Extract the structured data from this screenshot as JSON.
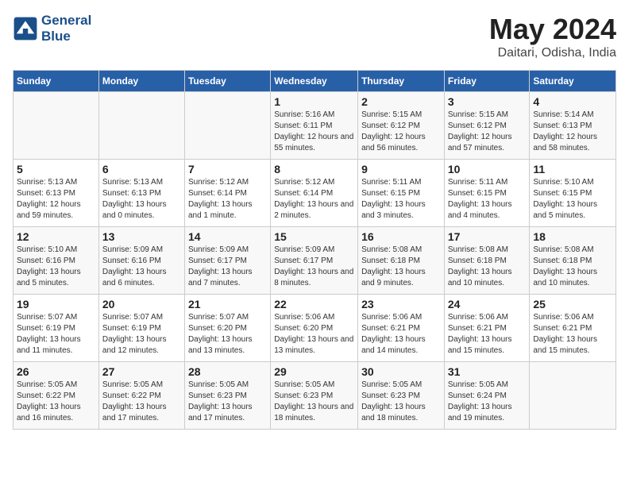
{
  "header": {
    "logo_line1": "General",
    "logo_line2": "Blue",
    "month": "May 2024",
    "location": "Daitari, Odisha, India"
  },
  "weekdays": [
    "Sunday",
    "Monday",
    "Tuesday",
    "Wednesday",
    "Thursday",
    "Friday",
    "Saturday"
  ],
  "weeks": [
    [
      {
        "day": "",
        "info": ""
      },
      {
        "day": "",
        "info": ""
      },
      {
        "day": "",
        "info": ""
      },
      {
        "day": "1",
        "sunrise": "Sunrise: 5:16 AM",
        "sunset": "Sunset: 6:11 PM",
        "daylight": "Daylight: 12 hours and 55 minutes."
      },
      {
        "day": "2",
        "sunrise": "Sunrise: 5:15 AM",
        "sunset": "Sunset: 6:12 PM",
        "daylight": "Daylight: 12 hours and 56 minutes."
      },
      {
        "day": "3",
        "sunrise": "Sunrise: 5:15 AM",
        "sunset": "Sunset: 6:12 PM",
        "daylight": "Daylight: 12 hours and 57 minutes."
      },
      {
        "day": "4",
        "sunrise": "Sunrise: 5:14 AM",
        "sunset": "Sunset: 6:13 PM",
        "daylight": "Daylight: 12 hours and 58 minutes."
      }
    ],
    [
      {
        "day": "5",
        "sunrise": "Sunrise: 5:13 AM",
        "sunset": "Sunset: 6:13 PM",
        "daylight": "Daylight: 12 hours and 59 minutes."
      },
      {
        "day": "6",
        "sunrise": "Sunrise: 5:13 AM",
        "sunset": "Sunset: 6:13 PM",
        "daylight": "Daylight: 13 hours and 0 minutes."
      },
      {
        "day": "7",
        "sunrise": "Sunrise: 5:12 AM",
        "sunset": "Sunset: 6:14 PM",
        "daylight": "Daylight: 13 hours and 1 minute."
      },
      {
        "day": "8",
        "sunrise": "Sunrise: 5:12 AM",
        "sunset": "Sunset: 6:14 PM",
        "daylight": "Daylight: 13 hours and 2 minutes."
      },
      {
        "day": "9",
        "sunrise": "Sunrise: 5:11 AM",
        "sunset": "Sunset: 6:15 PM",
        "daylight": "Daylight: 13 hours and 3 minutes."
      },
      {
        "day": "10",
        "sunrise": "Sunrise: 5:11 AM",
        "sunset": "Sunset: 6:15 PM",
        "daylight": "Daylight: 13 hours and 4 minutes."
      },
      {
        "day": "11",
        "sunrise": "Sunrise: 5:10 AM",
        "sunset": "Sunset: 6:15 PM",
        "daylight": "Daylight: 13 hours and 5 minutes."
      }
    ],
    [
      {
        "day": "12",
        "sunrise": "Sunrise: 5:10 AM",
        "sunset": "Sunset: 6:16 PM",
        "daylight": "Daylight: 13 hours and 5 minutes."
      },
      {
        "day": "13",
        "sunrise": "Sunrise: 5:09 AM",
        "sunset": "Sunset: 6:16 PM",
        "daylight": "Daylight: 13 hours and 6 minutes."
      },
      {
        "day": "14",
        "sunrise": "Sunrise: 5:09 AM",
        "sunset": "Sunset: 6:17 PM",
        "daylight": "Daylight: 13 hours and 7 minutes."
      },
      {
        "day": "15",
        "sunrise": "Sunrise: 5:09 AM",
        "sunset": "Sunset: 6:17 PM",
        "daylight": "Daylight: 13 hours and 8 minutes."
      },
      {
        "day": "16",
        "sunrise": "Sunrise: 5:08 AM",
        "sunset": "Sunset: 6:18 PM",
        "daylight": "Daylight: 13 hours and 9 minutes."
      },
      {
        "day": "17",
        "sunrise": "Sunrise: 5:08 AM",
        "sunset": "Sunset: 6:18 PM",
        "daylight": "Daylight: 13 hours and 10 minutes."
      },
      {
        "day": "18",
        "sunrise": "Sunrise: 5:08 AM",
        "sunset": "Sunset: 6:18 PM",
        "daylight": "Daylight: 13 hours and 10 minutes."
      }
    ],
    [
      {
        "day": "19",
        "sunrise": "Sunrise: 5:07 AM",
        "sunset": "Sunset: 6:19 PM",
        "daylight": "Daylight: 13 hours and 11 minutes."
      },
      {
        "day": "20",
        "sunrise": "Sunrise: 5:07 AM",
        "sunset": "Sunset: 6:19 PM",
        "daylight": "Daylight: 13 hours and 12 minutes."
      },
      {
        "day": "21",
        "sunrise": "Sunrise: 5:07 AM",
        "sunset": "Sunset: 6:20 PM",
        "daylight": "Daylight: 13 hours and 13 minutes."
      },
      {
        "day": "22",
        "sunrise": "Sunrise: 5:06 AM",
        "sunset": "Sunset: 6:20 PM",
        "daylight": "Daylight: 13 hours and 13 minutes."
      },
      {
        "day": "23",
        "sunrise": "Sunrise: 5:06 AM",
        "sunset": "Sunset: 6:21 PM",
        "daylight": "Daylight: 13 hours and 14 minutes."
      },
      {
        "day": "24",
        "sunrise": "Sunrise: 5:06 AM",
        "sunset": "Sunset: 6:21 PM",
        "daylight": "Daylight: 13 hours and 15 minutes."
      },
      {
        "day": "25",
        "sunrise": "Sunrise: 5:06 AM",
        "sunset": "Sunset: 6:21 PM",
        "daylight": "Daylight: 13 hours and 15 minutes."
      }
    ],
    [
      {
        "day": "26",
        "sunrise": "Sunrise: 5:05 AM",
        "sunset": "Sunset: 6:22 PM",
        "daylight": "Daylight: 13 hours and 16 minutes."
      },
      {
        "day": "27",
        "sunrise": "Sunrise: 5:05 AM",
        "sunset": "Sunset: 6:22 PM",
        "daylight": "Daylight: 13 hours and 17 minutes."
      },
      {
        "day": "28",
        "sunrise": "Sunrise: 5:05 AM",
        "sunset": "Sunset: 6:23 PM",
        "daylight": "Daylight: 13 hours and 17 minutes."
      },
      {
        "day": "29",
        "sunrise": "Sunrise: 5:05 AM",
        "sunset": "Sunset: 6:23 PM",
        "daylight": "Daylight: 13 hours and 18 minutes."
      },
      {
        "day": "30",
        "sunrise": "Sunrise: 5:05 AM",
        "sunset": "Sunset: 6:23 PM",
        "daylight": "Daylight: 13 hours and 18 minutes."
      },
      {
        "day": "31",
        "sunrise": "Sunrise: 5:05 AM",
        "sunset": "Sunset: 6:24 PM",
        "daylight": "Daylight: 13 hours and 19 minutes."
      },
      {
        "day": "",
        "info": ""
      }
    ]
  ]
}
